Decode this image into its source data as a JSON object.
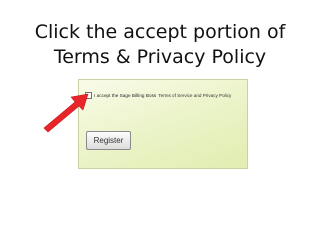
{
  "slide": {
    "title_line1": "Click the accept portion of",
    "title_line2": "Terms & Privacy Policy"
  },
  "form": {
    "accept_label": "I accept the Sage Billing Boss",
    "terms_link": "Terms of Service and Privacy Policy",
    "accept_checked": false,
    "register_label": "Register"
  },
  "colors": {
    "arrow": "#e8262a",
    "panel_background": "#eaf3c6"
  },
  "icons": {
    "pointer": "arrow-icon"
  }
}
